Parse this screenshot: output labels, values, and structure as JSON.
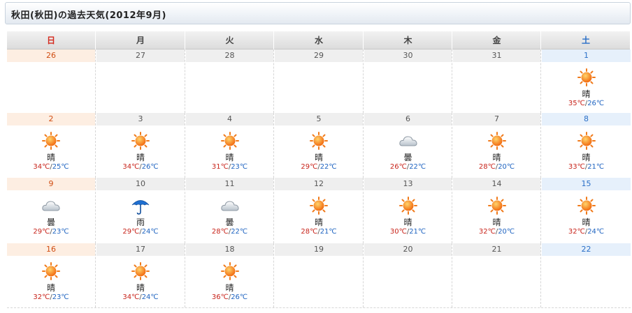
{
  "page": {
    "title": "秋田(秋田)の過去天気(2012年9月)"
  },
  "colors": {
    "sunday": "#d42a1e",
    "saturday": "#2a6fc7",
    "max_temp": "#c8241b",
    "min_temp": "#1f64c1"
  },
  "weekdays": [
    "日",
    "月",
    "火",
    "水",
    "木",
    "金",
    "土"
  ],
  "weeks": [
    [
      {
        "date": "26"
      },
      {
        "date": "27"
      },
      {
        "date": "28"
      },
      {
        "date": "29"
      },
      {
        "date": "30"
      },
      {
        "date": "31"
      },
      {
        "date": "1",
        "icon": "sun-icon",
        "weather": "晴",
        "max": "35℃",
        "min": "26℃"
      }
    ],
    [
      {
        "date": "2",
        "icon": "sun-icon",
        "weather": "晴",
        "max": "34℃",
        "min": "25℃"
      },
      {
        "date": "3",
        "icon": "sun-icon",
        "weather": "晴",
        "max": "34℃",
        "min": "26℃"
      },
      {
        "date": "4",
        "icon": "sun-icon",
        "weather": "晴",
        "max": "31℃",
        "min": "23℃"
      },
      {
        "date": "5",
        "icon": "sun-icon",
        "weather": "晴",
        "max": "29℃",
        "min": "22℃"
      },
      {
        "date": "6",
        "icon": "cloud-icon",
        "weather": "曇",
        "max": "26℃",
        "min": "22℃"
      },
      {
        "date": "7",
        "icon": "sun-icon",
        "weather": "晴",
        "max": "28℃",
        "min": "20℃"
      },
      {
        "date": "8",
        "icon": "sun-icon",
        "weather": "晴",
        "max": "33℃",
        "min": "21℃"
      }
    ],
    [
      {
        "date": "9",
        "icon": "cloud-icon",
        "weather": "曇",
        "max": "29℃",
        "min": "23℃"
      },
      {
        "date": "10",
        "icon": "umbrella-icon",
        "weather": "雨",
        "max": "29℃",
        "min": "24℃"
      },
      {
        "date": "11",
        "icon": "cloud-icon",
        "weather": "曇",
        "max": "28℃",
        "min": "22℃"
      },
      {
        "date": "12",
        "icon": "sun-icon",
        "weather": "晴",
        "max": "28℃",
        "min": "21℃"
      },
      {
        "date": "13",
        "icon": "sun-icon",
        "weather": "晴",
        "max": "30℃",
        "min": "21℃"
      },
      {
        "date": "14",
        "icon": "sun-icon",
        "weather": "晴",
        "max": "32℃",
        "min": "20℃"
      },
      {
        "date": "15",
        "icon": "sun-icon",
        "weather": "晴",
        "max": "32℃",
        "min": "24℃"
      }
    ],
    [
      {
        "date": "16",
        "icon": "sun-icon",
        "weather": "晴",
        "max": "32℃",
        "min": "23℃"
      },
      {
        "date": "17",
        "icon": "sun-icon",
        "weather": "晴",
        "max": "34℃",
        "min": "24℃"
      },
      {
        "date": "18",
        "icon": "sun-icon",
        "weather": "晴",
        "max": "36℃",
        "min": "26℃"
      },
      {
        "date": "19"
      },
      {
        "date": "20"
      },
      {
        "date": "21"
      },
      {
        "date": "22"
      }
    ]
  ]
}
